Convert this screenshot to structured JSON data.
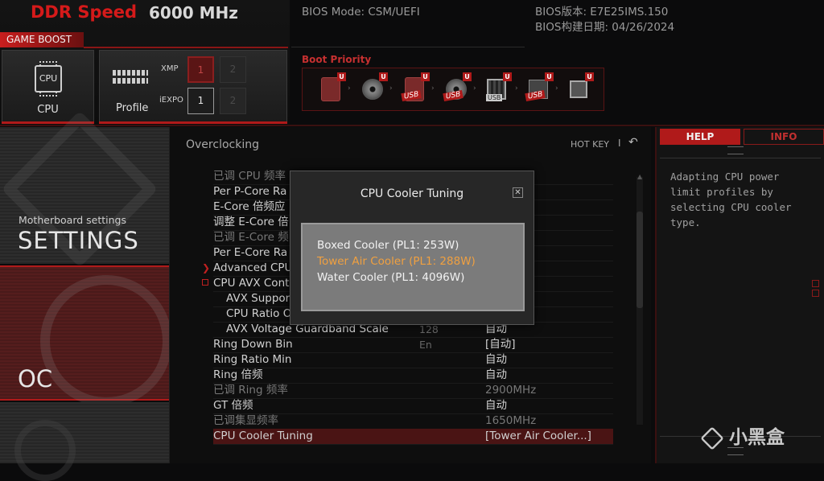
{
  "header": {
    "ddr_label": "DDR Speed",
    "ddr_value": "6000 MHz",
    "bios_mode": "BIOS Mode: CSM/UEFI",
    "bios_version": "BIOS版本: E7E25IMS.150",
    "bios_date": "BIOS构建日期: 04/26/2024"
  },
  "game_boost": {
    "label": "GAME BOOST",
    "cpu_label": "CPU",
    "cpu_chip_text": "CPU",
    "profile_label": "Profile",
    "xmp_label": "XMP",
    "iexpo_label": "iEXPO",
    "xmp_options": [
      "1",
      "2"
    ],
    "iexpo_options": [
      "1",
      "2"
    ]
  },
  "boot": {
    "title": "Boot Priority",
    "badge": "U",
    "usb_text": "USB",
    "devices": [
      "hdd-icon",
      "optical-disc-icon",
      "usb-hdd-icon",
      "usb-cd-icon",
      "usb-key-icon",
      "usb-floppy-icon",
      "uefi-shell-icon"
    ]
  },
  "nav": {
    "settings_sub": "Motherboard settings",
    "settings_main": "SETTINGS",
    "oc_main": "OC"
  },
  "center": {
    "title": "Overclocking",
    "hotkey": "HOT KEY",
    "hotkey_sep": "I",
    "rows": [
      {
        "name": "已调 CPU 频率",
        "mid": "",
        "val": "",
        "dim": true
      },
      {
        "name": "Per P-Core Ra",
        "mid": "",
        "val": ""
      },
      {
        "name": "E-Core 倍频应",
        "mid": "",
        "val": ""
      },
      {
        "name": "调整 E-Core 倍",
        "mid": "",
        "val": ""
      },
      {
        "name": "已调 E-Core 频",
        "mid": "",
        "val": "",
        "dim": true
      },
      {
        "name": "Per E-Core Ra",
        "mid": "",
        "val": ""
      },
      {
        "name": "Advanced CPU",
        "mid": "",
        "val": ""
      },
      {
        "name": "CPU AVX Contr",
        "mid": "",
        "val": ""
      },
      {
        "name": "AVX Suppor",
        "mid": "",
        "val": ""
      },
      {
        "name": "CPU Ratio O",
        "mid": "",
        "val": ""
      },
      {
        "name": "AVX Voltage Guardband Scale",
        "mid": "128",
        "val": "自动"
      },
      {
        "name": "Ring Down Bin",
        "mid": "En",
        "val": "[自动]"
      },
      {
        "name": "Ring Ratio Min",
        "mid": "",
        "val": "自动"
      },
      {
        "name": "Ring 倍频",
        "mid": "",
        "val": "自动"
      },
      {
        "name": "已调 Ring 频率",
        "mid": "",
        "val": "2900MHz",
        "dim": true
      },
      {
        "name": "GT 倍频",
        "mid": "",
        "val": "自动"
      },
      {
        "name": "已调集显频率",
        "mid": "",
        "val": "1650MHz",
        "dim": true
      },
      {
        "name": "CPU Cooler Tuning",
        "mid": "",
        "val": "[Tower Air Cooler...]",
        "selected": true
      }
    ]
  },
  "help": {
    "tab_help": "HELP",
    "tab_info": "INFO",
    "text": "Adapting CPU power limit profiles by selecting CPU cooler type."
  },
  "modal": {
    "title": "CPU Cooler Tuning",
    "close": "✕",
    "options": [
      "Boxed Cooler (PL1: 253W)",
      "Tower Air Cooler (PL1: 288W)",
      "Water Cooler (PL1: 4096W)"
    ],
    "selected_index": 1
  },
  "watermark": "小黑盒",
  "colors": {
    "accent": "#b01a1a",
    "selected_option": "#f0a040"
  }
}
